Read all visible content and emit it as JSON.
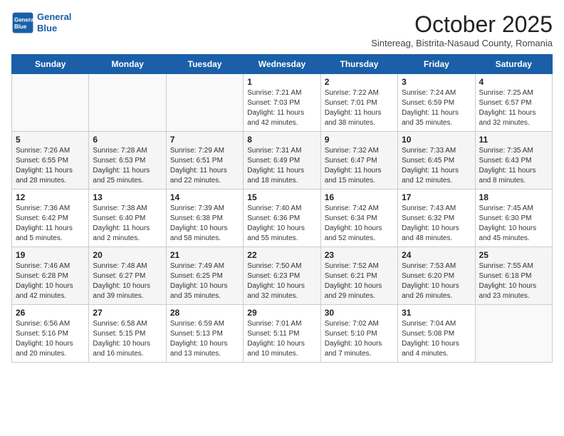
{
  "header": {
    "logo_line1": "General",
    "logo_line2": "Blue",
    "month": "October 2025",
    "location": "Sintereag, Bistrita-Nasaud County, Romania"
  },
  "weekdays": [
    "Sunday",
    "Monday",
    "Tuesday",
    "Wednesday",
    "Thursday",
    "Friday",
    "Saturday"
  ],
  "weeks": [
    [
      {
        "day": "",
        "info": ""
      },
      {
        "day": "",
        "info": ""
      },
      {
        "day": "",
        "info": ""
      },
      {
        "day": "1",
        "info": "Sunrise: 7:21 AM\nSunset: 7:03 PM\nDaylight: 11 hours\nand 42 minutes."
      },
      {
        "day": "2",
        "info": "Sunrise: 7:22 AM\nSunset: 7:01 PM\nDaylight: 11 hours\nand 38 minutes."
      },
      {
        "day": "3",
        "info": "Sunrise: 7:24 AM\nSunset: 6:59 PM\nDaylight: 11 hours\nand 35 minutes."
      },
      {
        "day": "4",
        "info": "Sunrise: 7:25 AM\nSunset: 6:57 PM\nDaylight: 11 hours\nand 32 minutes."
      }
    ],
    [
      {
        "day": "5",
        "info": "Sunrise: 7:26 AM\nSunset: 6:55 PM\nDaylight: 11 hours\nand 28 minutes."
      },
      {
        "day": "6",
        "info": "Sunrise: 7:28 AM\nSunset: 6:53 PM\nDaylight: 11 hours\nand 25 minutes."
      },
      {
        "day": "7",
        "info": "Sunrise: 7:29 AM\nSunset: 6:51 PM\nDaylight: 11 hours\nand 22 minutes."
      },
      {
        "day": "8",
        "info": "Sunrise: 7:31 AM\nSunset: 6:49 PM\nDaylight: 11 hours\nand 18 minutes."
      },
      {
        "day": "9",
        "info": "Sunrise: 7:32 AM\nSunset: 6:47 PM\nDaylight: 11 hours\nand 15 minutes."
      },
      {
        "day": "10",
        "info": "Sunrise: 7:33 AM\nSunset: 6:45 PM\nDaylight: 11 hours\nand 12 minutes."
      },
      {
        "day": "11",
        "info": "Sunrise: 7:35 AM\nSunset: 6:43 PM\nDaylight: 11 hours\nand 8 minutes."
      }
    ],
    [
      {
        "day": "12",
        "info": "Sunrise: 7:36 AM\nSunset: 6:42 PM\nDaylight: 11 hours\nand 5 minutes."
      },
      {
        "day": "13",
        "info": "Sunrise: 7:38 AM\nSunset: 6:40 PM\nDaylight: 11 hours\nand 2 minutes."
      },
      {
        "day": "14",
        "info": "Sunrise: 7:39 AM\nSunset: 6:38 PM\nDaylight: 10 hours\nand 58 minutes."
      },
      {
        "day": "15",
        "info": "Sunrise: 7:40 AM\nSunset: 6:36 PM\nDaylight: 10 hours\nand 55 minutes."
      },
      {
        "day": "16",
        "info": "Sunrise: 7:42 AM\nSunset: 6:34 PM\nDaylight: 10 hours\nand 52 minutes."
      },
      {
        "day": "17",
        "info": "Sunrise: 7:43 AM\nSunset: 6:32 PM\nDaylight: 10 hours\nand 48 minutes."
      },
      {
        "day": "18",
        "info": "Sunrise: 7:45 AM\nSunset: 6:30 PM\nDaylight: 10 hours\nand 45 minutes."
      }
    ],
    [
      {
        "day": "19",
        "info": "Sunrise: 7:46 AM\nSunset: 6:28 PM\nDaylight: 10 hours\nand 42 minutes."
      },
      {
        "day": "20",
        "info": "Sunrise: 7:48 AM\nSunset: 6:27 PM\nDaylight: 10 hours\nand 39 minutes."
      },
      {
        "day": "21",
        "info": "Sunrise: 7:49 AM\nSunset: 6:25 PM\nDaylight: 10 hours\nand 35 minutes."
      },
      {
        "day": "22",
        "info": "Sunrise: 7:50 AM\nSunset: 6:23 PM\nDaylight: 10 hours\nand 32 minutes."
      },
      {
        "day": "23",
        "info": "Sunrise: 7:52 AM\nSunset: 6:21 PM\nDaylight: 10 hours\nand 29 minutes."
      },
      {
        "day": "24",
        "info": "Sunrise: 7:53 AM\nSunset: 6:20 PM\nDaylight: 10 hours\nand 26 minutes."
      },
      {
        "day": "25",
        "info": "Sunrise: 7:55 AM\nSunset: 6:18 PM\nDaylight: 10 hours\nand 23 minutes."
      }
    ],
    [
      {
        "day": "26",
        "info": "Sunrise: 6:56 AM\nSunset: 5:16 PM\nDaylight: 10 hours\nand 20 minutes."
      },
      {
        "day": "27",
        "info": "Sunrise: 6:58 AM\nSunset: 5:15 PM\nDaylight: 10 hours\nand 16 minutes."
      },
      {
        "day": "28",
        "info": "Sunrise: 6:59 AM\nSunset: 5:13 PM\nDaylight: 10 hours\nand 13 minutes."
      },
      {
        "day": "29",
        "info": "Sunrise: 7:01 AM\nSunset: 5:11 PM\nDaylight: 10 hours\nand 10 minutes."
      },
      {
        "day": "30",
        "info": "Sunrise: 7:02 AM\nSunset: 5:10 PM\nDaylight: 10 hours\nand 7 minutes."
      },
      {
        "day": "31",
        "info": "Sunrise: 7:04 AM\nSunset: 5:08 PM\nDaylight: 10 hours\nand 4 minutes."
      },
      {
        "day": "",
        "info": ""
      }
    ]
  ]
}
